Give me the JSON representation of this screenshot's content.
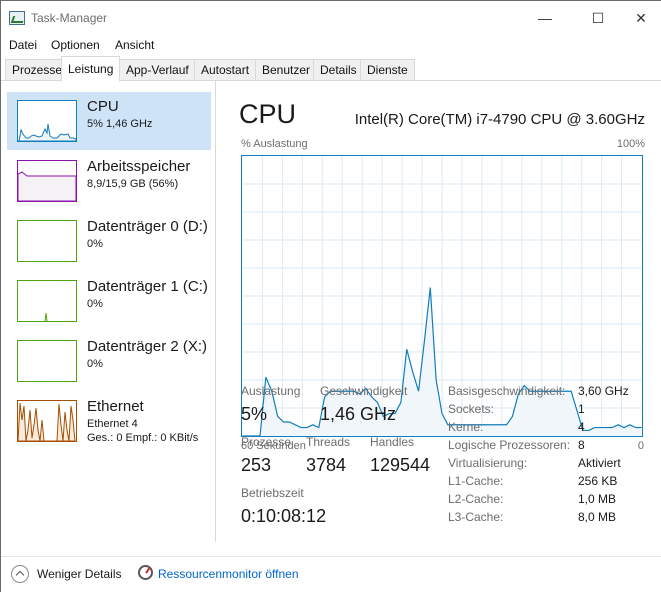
{
  "window": {
    "title": "Task-Manager",
    "minimize_glyph": "—",
    "maximize_glyph": "☐",
    "close_glyph": "✕"
  },
  "menu": [
    "Datei",
    "Optionen",
    "Ansicht"
  ],
  "tabs": [
    {
      "label": "Prozesse",
      "active": false
    },
    {
      "label": "Leistung",
      "active": true
    },
    {
      "label": "App-Verlauf",
      "active": false
    },
    {
      "label": "Autostart",
      "active": false
    },
    {
      "label": "Benutzer",
      "active": false
    },
    {
      "label": "Details",
      "active": false
    },
    {
      "label": "Dienste",
      "active": false
    }
  ],
  "sidebar": {
    "items": [
      {
        "name": "CPU",
        "sub": "5% 1,46 GHz",
        "sub2": "",
        "color": "#117dbb",
        "selected": true
      },
      {
        "name": "Arbeitsspeicher",
        "sub": "8,9/15,9 GB (56%)",
        "sub2": "",
        "color": "#8b12ae",
        "selected": false
      },
      {
        "name": "Datenträger 0 (D:)",
        "sub": "0%",
        "sub2": "",
        "color": "#4da60c",
        "selected": false
      },
      {
        "name": "Datenträger 1 (C:)",
        "sub": "0%",
        "sub2": "",
        "color": "#4da60c",
        "selected": false
      },
      {
        "name": "Datenträger 2 (X:)",
        "sub": "0%",
        "sub2": "",
        "color": "#4da60c",
        "selected": false
      },
      {
        "name": "Ethernet",
        "sub": "Ethernet 4",
        "sub2": "Ges.: 0 Empf.: 0 KBit/s",
        "color": "#a74f01",
        "selected": false
      }
    ]
  },
  "main": {
    "title": "CPU",
    "model": "Intel(R) Core(TM) i7-4790 CPU @ 3.60GHz",
    "graph_label_left": "% Auslastung",
    "graph_label_right": "100%",
    "graph_bottom_left": "60 Sekunden",
    "graph_bottom_right": "0",
    "graph_color": "#117dbb",
    "graph_fill": "#f1f6fa",
    "graph_grid_color": "#d9eaf4",
    "utilization_series": [
      0,
      0,
      0,
      0,
      21,
      16,
      7,
      5,
      5,
      4,
      3,
      3,
      4,
      3,
      14,
      16,
      16,
      16,
      16,
      16,
      15,
      17,
      14,
      12,
      7,
      8,
      8,
      12,
      31,
      23,
      16,
      34,
      53,
      20,
      8,
      4,
      4,
      4,
      4,
      4,
      4,
      4,
      4,
      4,
      4,
      4,
      7,
      15,
      18,
      16,
      16,
      16,
      16,
      16,
      16,
      16,
      16,
      9,
      2,
      2,
      3,
      3,
      3,
      3,
      4,
      3,
      4,
      3,
      3
    ]
  },
  "stats": {
    "auslastung_label": "Auslastung",
    "auslastung_value": "5%",
    "geschwindigkeit_label": "Geschwindigkeit",
    "geschwindigkeit_value": "1,46 GHz",
    "prozesse_label": "Prozesse",
    "prozesse_value": "253",
    "threads_label": "Threads",
    "threads_value": "3784",
    "handles_label": "Handles",
    "handles_value": "129544",
    "betriebszeit_label": "Betriebszeit",
    "betriebszeit_value": "0:10:08:12"
  },
  "info": [
    {
      "label": "Basisgeschwindigkeit:",
      "value": "3,60 GHz"
    },
    {
      "label": "Sockets:",
      "value": "1"
    },
    {
      "label": "Kerne:",
      "value": "4"
    },
    {
      "label": "Logische Prozessoren:",
      "value": "8"
    },
    {
      "label": "Virtualisierung:",
      "value": "Aktiviert"
    },
    {
      "label": "L1-Cache:",
      "value": "256 KB"
    },
    {
      "label": "L2-Cache:",
      "value": "1,0 MB"
    },
    {
      "label": "L3-Cache:",
      "value": "8,0 MB"
    }
  ],
  "footer": {
    "less_details": "Weniger Details",
    "resmon": "Ressourcenmonitor öffnen",
    "link_color": "#0066cc"
  }
}
